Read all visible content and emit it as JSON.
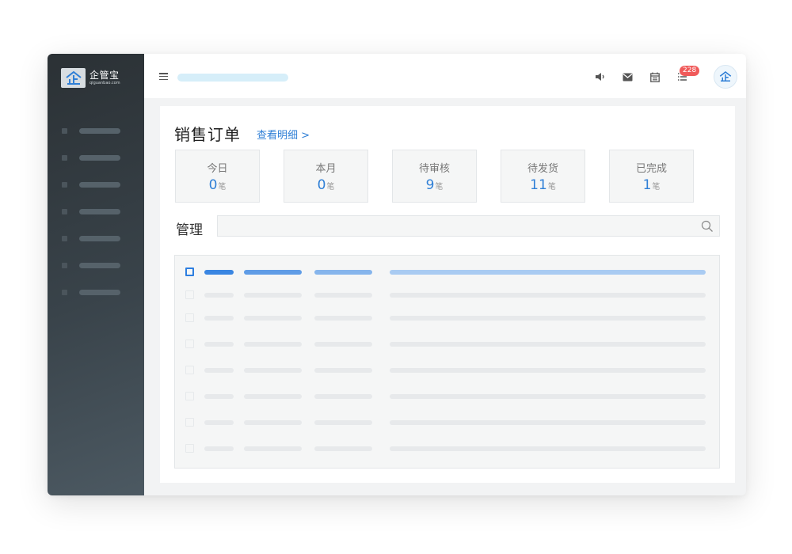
{
  "brand": {
    "name": "企管宝",
    "domain": "qiguanbao.com",
    "logo_glyph": "企"
  },
  "sidebar": {
    "items": [
      {
        "icon": "nav-dot"
      },
      {
        "icon": "nav-dot"
      },
      {
        "icon": "nav-dot"
      },
      {
        "icon": "nav-dot"
      },
      {
        "icon": "nav-dot"
      },
      {
        "icon": "nav-dot"
      },
      {
        "icon": "nav-dot"
      }
    ]
  },
  "header": {
    "icons": [
      "speaker-icon",
      "mail-icon",
      "calendar-icon",
      "list-icon"
    ],
    "notification_count": "228",
    "avatar_glyph": "企"
  },
  "page": {
    "title": "销售订单",
    "detail_link": "查看明细 >"
  },
  "stats": [
    {
      "label": "今日",
      "value": "0",
      "unit": "笔"
    },
    {
      "label": "本月",
      "value": "0",
      "unit": "笔"
    },
    {
      "label": "待审核",
      "value": "9",
      "unit": "笔"
    },
    {
      "label": "待发货",
      "value": "11",
      "unit": "笔"
    },
    {
      "label": "已完成",
      "value": "1",
      "unit": "笔"
    }
  ],
  "manage": {
    "label": "管理",
    "search_placeholder": ""
  },
  "colors": {
    "accent": "#2f7fd6",
    "badge": "#f05a5a",
    "sidebar_dark": "#2b3135"
  }
}
